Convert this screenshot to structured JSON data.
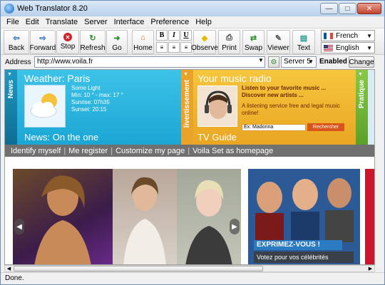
{
  "window": {
    "title": "Web Translator 8.20"
  },
  "menu": [
    "File",
    "Edit",
    "Translate",
    "Server",
    "Interface",
    "Preference",
    "Help"
  ],
  "toolbar": {
    "back": "Back",
    "forward": "Forward",
    "stop": "Stop",
    "refresh": "Refresh",
    "go": "Go",
    "home": "Home",
    "bold": "B",
    "italic": "I",
    "underline": "U",
    "observe": "Observe",
    "print": "Print",
    "swap": "Swap",
    "viewer": "Viewer",
    "text": "Text"
  },
  "languages": {
    "source": "French",
    "target": "English"
  },
  "address": {
    "label": "Address",
    "url": "http://www.voila.fr",
    "server": "Server 5",
    "status": "Enabled",
    "change": "Change"
  },
  "page": {
    "news_tab": "News",
    "weather_title": "Weather: Paris",
    "weather_lines": [
      "Some Light",
      "Min: 10 ° - max: 17 °",
      "Sunrise: 07h35",
      "Sunset: 20:15"
    ],
    "news_footer": "News: On the one",
    "adv_tab": "livertissement",
    "music_title": "Your music radio",
    "music_tagline": "Listen to your favorite music ... Discover new artists ...",
    "music_sub": "A listening service free and legal music online!",
    "music_search": "Ex: Madonna",
    "music_button": "Rechercher",
    "tv_guide": "TV Guide",
    "prat_tab": "Pratique",
    "links": [
      "Identify myself",
      "Me register",
      "Customize my page",
      "Voila Set as homepage"
    ],
    "promo_banner": "EXPRIMEZ-VOUS !",
    "promo_sub": "Votez pour vos célébrités"
  },
  "status": "Done.",
  "colors": {
    "weather_blue": "#1ba6d4",
    "music_yellow": "#e9a623",
    "link_bar": "#707070",
    "praticque_green": "#5aa12a"
  }
}
